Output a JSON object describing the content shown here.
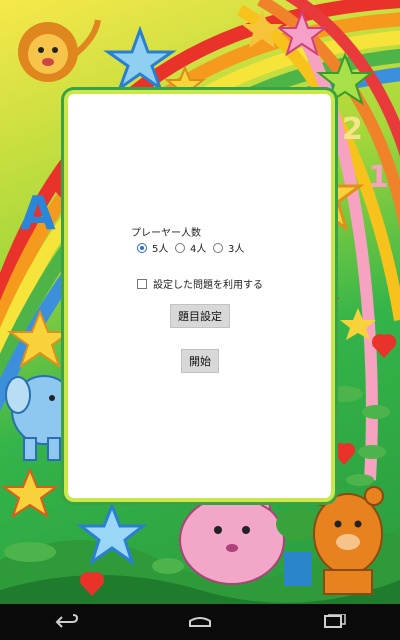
{
  "form": {
    "players_label": "プレーヤー人数",
    "player_options": [
      {
        "label": "5人",
        "selected": true
      },
      {
        "label": "4人",
        "selected": false
      },
      {
        "label": "3人",
        "selected": false
      }
    ],
    "use_saved_label": "設定した問題を利用する",
    "use_saved_checked": false,
    "set_questions_button": "題目設定",
    "start_button": "開始"
  },
  "decor": {
    "letter_a": "A",
    "number_2": "2",
    "number_1": "1"
  },
  "navbar": {
    "buttons": [
      "back-icon",
      "home-icon",
      "recent-apps-icon"
    ]
  },
  "colors": {
    "radio_accent": "#2a6fc4",
    "button_bg": "#d8d8d8",
    "navbar_bg": "#0a0a0a"
  }
}
